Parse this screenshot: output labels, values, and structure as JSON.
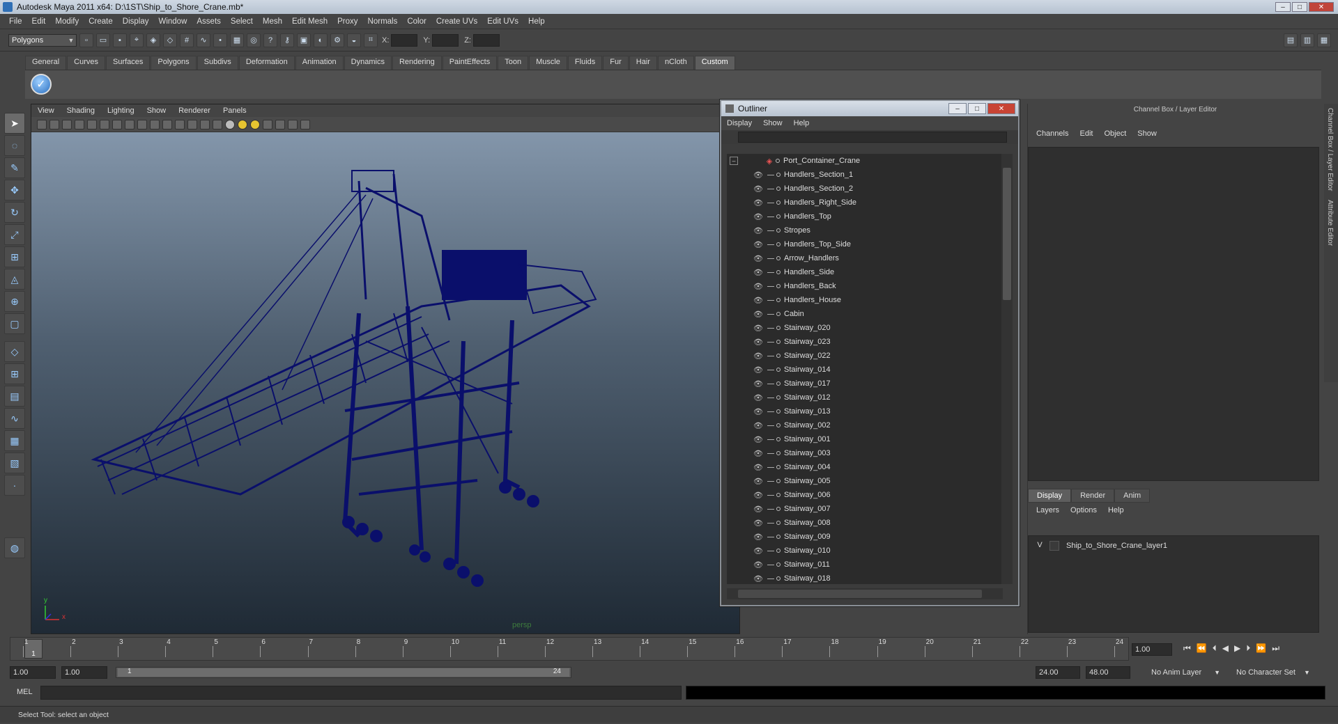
{
  "window": {
    "title": "Autodesk Maya 2011 x64: D:\\1ST\\Ship_to_Shore_Crane.mb*"
  },
  "menubar": [
    "File",
    "Edit",
    "Modify",
    "Create",
    "Display",
    "Window",
    "Assets",
    "Select",
    "Mesh",
    "Edit Mesh",
    "Proxy",
    "Normals",
    "Color",
    "Create UVs",
    "Edit UVs",
    "Help"
  ],
  "toolbar": {
    "mode_selector": "Polygons",
    "coord_x_label": "X:",
    "coord_y_label": "Y:",
    "coord_z_label": "Z:"
  },
  "shelf": {
    "tabs": [
      "General",
      "Curves",
      "Surfaces",
      "Polygons",
      "Subdivs",
      "Deformation",
      "Animation",
      "Dynamics",
      "Rendering",
      "PaintEffects",
      "Toon",
      "Muscle",
      "Fluids",
      "Fur",
      "Hair",
      "nCloth",
      "Custom"
    ],
    "active_tab": "Custom"
  },
  "viewport": {
    "menu": [
      "View",
      "Shading",
      "Lighting",
      "Show",
      "Renderer",
      "Panels"
    ],
    "camera_label": "persp",
    "axis_y": "y",
    "axis_x": "x",
    "wire_color": "#0a0f6b"
  },
  "outliner": {
    "title": "Outliner",
    "menu": [
      "Display",
      "Show",
      "Help"
    ],
    "root": "Port_Container_Crane",
    "items": [
      "Handlers_Section_1",
      "Handlers_Section_2",
      "Handlers_Right_Side",
      "Handlers_Top",
      "Stropes",
      "Handlers_Top_Side",
      "Arrow_Handlers",
      "Handlers_Side",
      "Handlers_Back",
      "Handlers_House",
      "Cabin",
      "Stairway_020",
      "Stairway_023",
      "Stairway_022",
      "Stairway_014",
      "Stairway_017",
      "Stairway_012",
      "Stairway_013",
      "Stairway_002",
      "Stairway_001",
      "Stairway_003",
      "Stairway_004",
      "Stairway_005",
      "Stairway_006",
      "Stairway_007",
      "Stairway_008",
      "Stairway_009",
      "Stairway_010",
      "Stairway_011",
      "Stairway_018"
    ]
  },
  "channelbox": {
    "header": "Channel Box / Layer Editor",
    "menu": [
      "Channels",
      "Edit",
      "Object",
      "Show"
    ],
    "tabs": [
      "Display",
      "Render",
      "Anim"
    ],
    "active_tab": "Display",
    "layer_menu": [
      "Layers",
      "Options",
      "Help"
    ],
    "layer_visible": "V",
    "layer_name": "Ship_to_Shore_Crane_layer1",
    "side_tabs": [
      "Channel Box / Layer Editor",
      "Attribute Editor"
    ]
  },
  "timeline": {
    "ticks": [
      "1",
      "2",
      "3",
      "4",
      "5",
      "6",
      "7",
      "8",
      "9",
      "10",
      "11",
      "12",
      "13",
      "14",
      "15",
      "16",
      "17",
      "18",
      "19",
      "20",
      "21",
      "22",
      "23",
      "24"
    ],
    "current_frame": "1",
    "current_time": "1.00"
  },
  "range": {
    "start_time": "1.00",
    "start_playback": "1.00",
    "slider_low": "1",
    "slider_high": "24",
    "end_playback": "24.00",
    "end_time": "48.00",
    "anim_layer": "No Anim Layer",
    "character_set": "No Character Set"
  },
  "command": {
    "label": "MEL"
  },
  "help_line": "Select Tool: select an object"
}
